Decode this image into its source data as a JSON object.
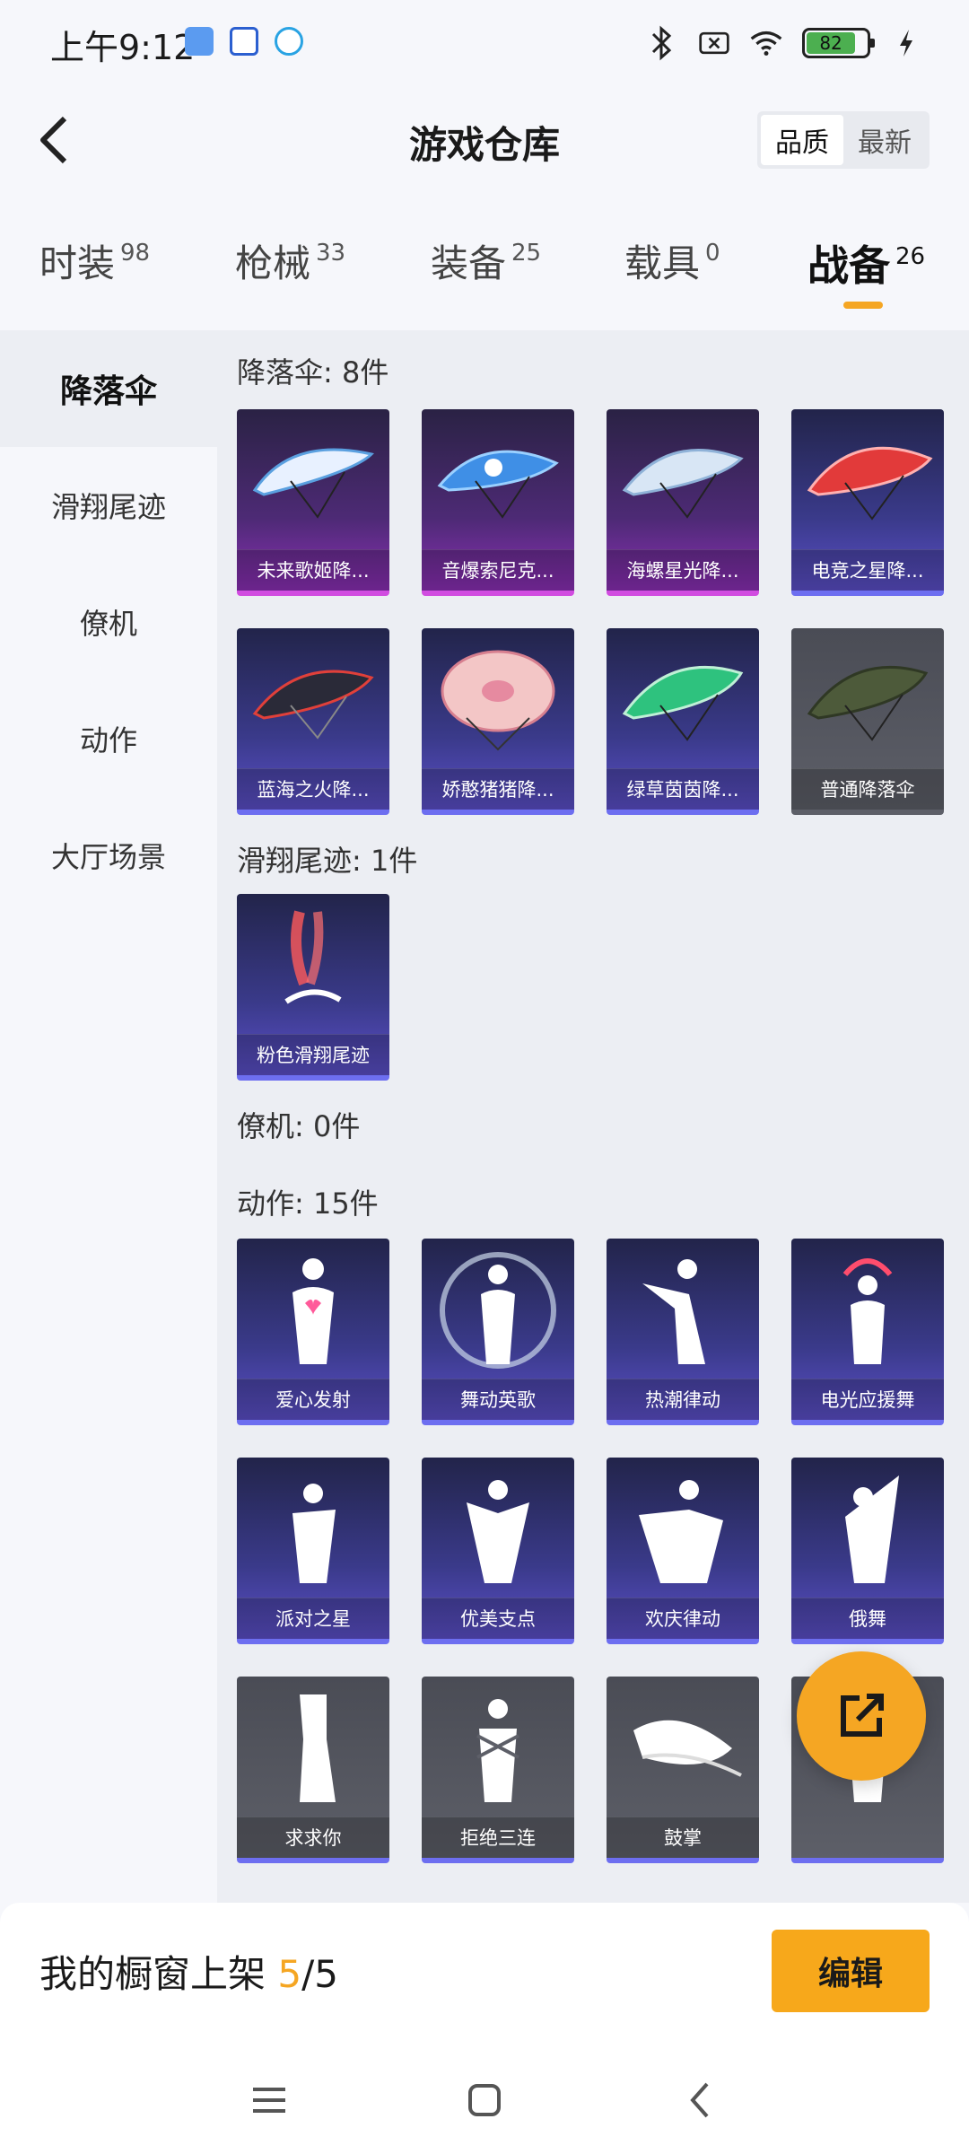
{
  "status_bar": {
    "time": "上午9:12",
    "battery": "82",
    "battery_level": 0.82
  },
  "header": {
    "title": "游戏仓库",
    "sort_options": [
      "品质",
      "最新"
    ],
    "sort_active": "品质"
  },
  "tabs": [
    {
      "label": "时装",
      "count": "98"
    },
    {
      "label": "枪械",
      "count": "33"
    },
    {
      "label": "装备",
      "count": "25"
    },
    {
      "label": "载具",
      "count": "0"
    },
    {
      "label": "战备",
      "count": "26"
    }
  ],
  "active_tab": "战备",
  "sidebar": {
    "items": [
      "降落伞",
      "滑翔尾迹",
      "僚机",
      "动作",
      "大厅场景"
    ],
    "active": "降落伞"
  },
  "sections": {
    "parachute": {
      "title": "降落伞: 8件",
      "items": [
        "未来歌姬降...",
        "音爆索尼克...",
        "海螺星光降...",
        "电竞之星降...",
        "蓝海之火降...",
        "娇憨猪猪降...",
        "绿草茵茵降...",
        "普通降落伞"
      ]
    },
    "trail": {
      "title": "滑翔尾迹: 1件",
      "items": [
        "粉色滑翔尾迹"
      ]
    },
    "wingman": {
      "title": "僚机: 0件"
    },
    "emote": {
      "title": "动作: 15件",
      "items": [
        "爱心发射",
        "舞动英歌",
        "热潮律动",
        "电光应援舞",
        "派对之星",
        "优美支点",
        "欢庆律动",
        "俄舞",
        "求求你",
        "拒绝三连",
        "鼓掌"
      ]
    }
  },
  "bottom_bar": {
    "showcase_label": "我的橱窗上架",
    "showcase_current": "5",
    "showcase_total": "/5",
    "edit_label": "编辑"
  },
  "colors": {
    "accent": "#f5a623",
    "card_purple": "#8b2fb5",
    "card_blue": "#5b4fc8",
    "card_gray": "#5d5f68"
  },
  "icons": [
    "back-arrow-icon",
    "bluetooth-icon",
    "sim-off-icon",
    "wifi-icon",
    "battery-icon",
    "charging-icon",
    "share-out-icon",
    "menu-icon",
    "home-icon",
    "nav-back-icon"
  ]
}
